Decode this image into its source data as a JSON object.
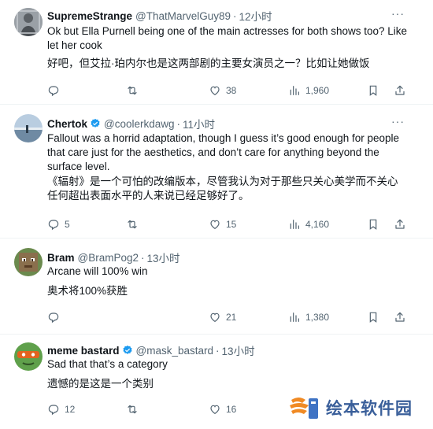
{
  "tweets": [
    {
      "name": "SupremeStrange",
      "handle": "@ThatMarvelGuy89",
      "dot": "·",
      "time": "12小时",
      "verified": false,
      "text_en": "Ok but Ella Purnell being one of the main actresses for both shows too? Like let her cook",
      "text_zh": "好吧，但艾拉·珀内尔也是这两部剧的主要女演员之一？比如让她做饭",
      "reply_count": "",
      "retweet_count": "",
      "like_count": "38",
      "view_count": "1,960"
    },
    {
      "name": "Chertok",
      "handle": "@coolerkdawg",
      "dot": "·",
      "time": "11小时",
      "verified": true,
      "text_en": "Fallout was a horrid adaptation, though I guess it’s good enough for people that care just for the aesthetics, and don’t care for anything beyond the surface level.",
      "text_zh": "《辐射》是一个可怕的改编版本，尽管我认为对于那些只关心美学而不关心任何超出表面水平的人来说已经足够好了。",
      "reply_count": "5",
      "retweet_count": "",
      "like_count": "15",
      "view_count": "4,160"
    },
    {
      "name": "Bram",
      "handle": "@BramPog2",
      "dot": "·",
      "time": "13小时",
      "verified": false,
      "text_en": "Arcane will 100% win",
      "text_zh": "奥术将100%获胜",
      "reply_count": "",
      "retweet_count": "",
      "like_count": "21",
      "view_count": "1,380"
    },
    {
      "name": "meme bastard",
      "handle": "@mask_bastard",
      "dot": "·",
      "time": "13小时",
      "verified": true,
      "text_en": "Sad that that’s a category",
      "text_zh": "遗憾的是这是一个类别",
      "reply_count": "12",
      "retweet_count": "",
      "like_count": "16",
      "view_count": ""
    }
  ],
  "more_glyph": "···",
  "watermark": {
    "text": "绘本软件园"
  },
  "colors": {
    "secondary": "#536471",
    "verified": "#1d9bf0",
    "text": "#0f1419",
    "divider": "#eff3f4"
  },
  "icons": [
    "reply-icon",
    "retweet-icon",
    "like-icon",
    "views-icon",
    "bookmark-icon",
    "share-icon",
    "more-icon",
    "verified-icon"
  ]
}
